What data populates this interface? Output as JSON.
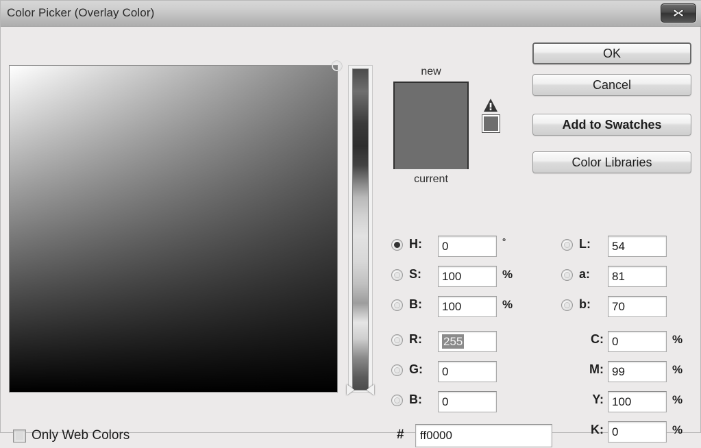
{
  "window": {
    "title": "Color Picker (Overlay Color)",
    "close_icon": "close-x-icon"
  },
  "buttons": {
    "ok": "OK",
    "cancel": "Cancel",
    "add_to_swatches": "Add to Swatches",
    "color_libraries": "Color Libraries"
  },
  "preview": {
    "new_label": "new",
    "current_label": "current",
    "new_color": "#ff0000",
    "current_color": "#ff0000",
    "display_color": "#6e6e6e",
    "gamut_warning_icon": "gamut-warning-triangle-icon",
    "gamut_alt_color": "#6e6e6e"
  },
  "color_field": {
    "selected_x_pct": 100,
    "selected_y_pct": 0
  },
  "hue_slider": {
    "value": 0
  },
  "hsb": [
    {
      "key": "H",
      "label": "H:",
      "value": "0",
      "unit": "°",
      "selected": true
    },
    {
      "key": "S",
      "label": "S:",
      "value": "100",
      "unit": "%",
      "selected": false
    },
    {
      "key": "B",
      "label": "B:",
      "value": "100",
      "unit": "%",
      "selected": false
    }
  ],
  "rgb": [
    {
      "key": "R",
      "label": "R:",
      "value": "255",
      "unit": "",
      "selected": false,
      "text_selected": true
    },
    {
      "key": "G",
      "label": "G:",
      "value": "0",
      "unit": "",
      "selected": false,
      "text_selected": false
    },
    {
      "key": "B",
      "label": "B:",
      "value": "0",
      "unit": "",
      "selected": false,
      "text_selected": false
    }
  ],
  "lab": [
    {
      "key": "L",
      "label": "L:",
      "value": "54",
      "unit": "",
      "selected": false
    },
    {
      "key": "a",
      "label": "a:",
      "value": "81",
      "unit": "",
      "selected": false
    },
    {
      "key": "b",
      "label": "b:",
      "value": "70",
      "unit": "",
      "selected": false
    }
  ],
  "cmyk": [
    {
      "key": "C",
      "label": "C:",
      "value": "0",
      "unit": "%"
    },
    {
      "key": "M",
      "label": "M:",
      "value": "99",
      "unit": "%"
    },
    {
      "key": "Y",
      "label": "Y:",
      "value": "100",
      "unit": "%"
    },
    {
      "key": "K",
      "label": "K:",
      "value": "0",
      "unit": "%"
    }
  ],
  "hex": {
    "hash": "#",
    "value": "ff0000"
  },
  "only_web_colors": {
    "label": "Only Web Colors",
    "checked": false
  }
}
